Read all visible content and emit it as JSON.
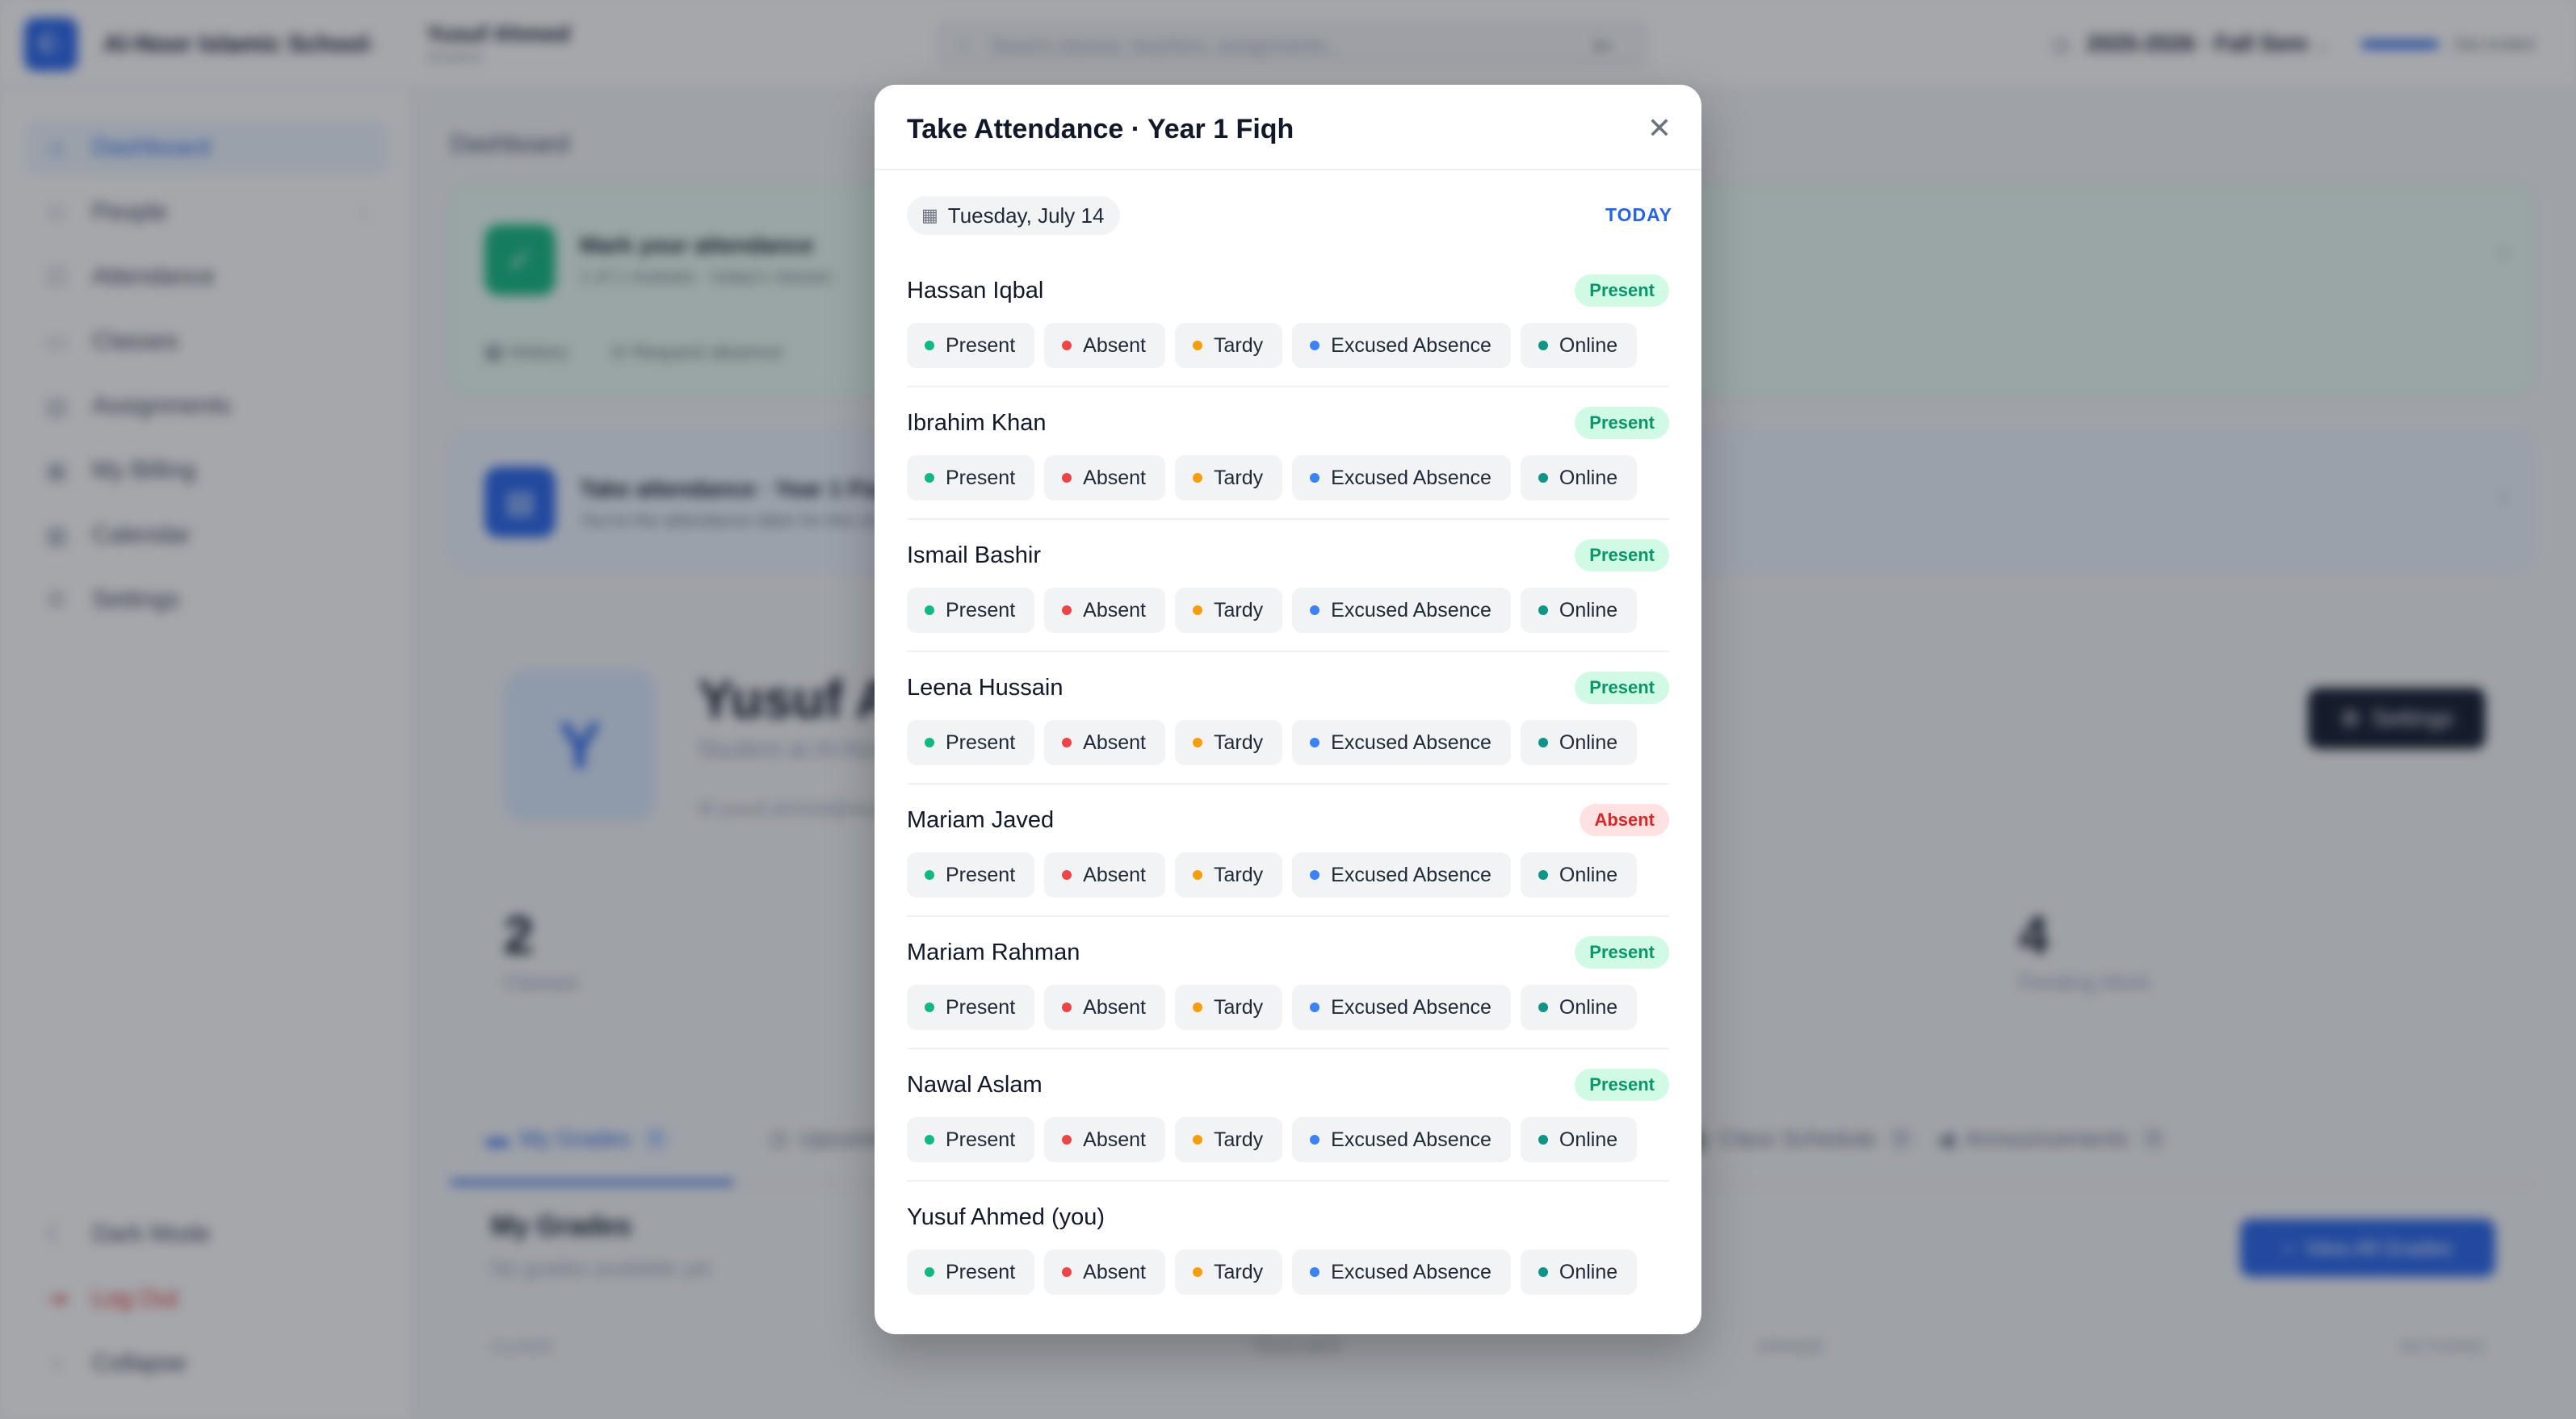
{
  "app": {
    "school_name": "Al-Noor Islamic School",
    "user_name": "Yusuf Ahmed",
    "user_role": "Student",
    "search_placeholder": "Search classes, teachers, assignments...",
    "search_shortcut": "⌘K",
    "school_year": "2025-2026 · Fall Sem",
    "progress_label": "Sat ended",
    "progress_fraction": 0.25
  },
  "sidebar": {
    "items": [
      {
        "label": "Dashboard",
        "icon": "home-icon",
        "active": true
      },
      {
        "label": "People",
        "icon": "people-icon",
        "has_children": true
      },
      {
        "label": "Attendance",
        "icon": "attendance-icon"
      },
      {
        "label": "Classes",
        "icon": "classes-icon"
      },
      {
        "label": "Assignments",
        "icon": "assignments-icon"
      },
      {
        "label": "My Billing",
        "icon": "billing-icon"
      },
      {
        "label": "Calendar",
        "icon": "calendar-icon"
      },
      {
        "label": "Settings",
        "icon": "settings-icon"
      }
    ],
    "bottom": [
      {
        "label": "Dark Mode",
        "icon": "moon-icon"
      },
      {
        "label": "Log Out",
        "icon": "logout-icon",
        "danger": true
      },
      {
        "label": "Collapse",
        "icon": "collapse-icon"
      }
    ]
  },
  "main": {
    "breadcrumb": "Dashboard",
    "attendance_card": {
      "title": "Mark your attendance",
      "subtitle": "1 of 1 modules · today's classes",
      "link_history": "History",
      "link_request": "Request absence"
    },
    "take_card": {
      "title": "Take attendance · Year 1 Fiqh",
      "subtitle": "You're the attendance taker for this class"
    },
    "profile": {
      "avatar_letter": "Y",
      "name": "Yusuf Ahmed",
      "subtitle": "Student at Al-Noor Islamic School",
      "email": "yusuf.ahmed@example.com",
      "settings_label": "Settings"
    },
    "stats": [
      {
        "value": "2",
        "label": "Classes"
      },
      {
        "value": "4",
        "label": "Pending Work"
      }
    ],
    "tabs": [
      {
        "label": "My Grades",
        "count": "0",
        "active": true
      },
      {
        "label": "Upcoming"
      },
      {
        "label": "Class Schedule",
        "count": "0"
      },
      {
        "label": "Announcements",
        "count": "0"
      }
    ],
    "grades": {
      "title": "My Grades",
      "subtitle": "No grades available yet",
      "view_all_label": "View All Grades",
      "columns": [
        "CLASS",
        "TEACHER",
        "GRADE",
        "ACTIONS"
      ]
    }
  },
  "modal": {
    "title": "Take Attendance · Year 1 Fiqh",
    "date": "Tuesday, July 14",
    "today_label": "TODAY",
    "options": [
      {
        "label": "Present",
        "color": "#10b981"
      },
      {
        "label": "Absent",
        "color": "#ef4444"
      },
      {
        "label": "Tardy",
        "color": "#f59e0b"
      },
      {
        "label": "Excused Absence",
        "color": "#3b82f6"
      },
      {
        "label": "Online",
        "color": "#0d9488"
      }
    ],
    "students": [
      {
        "name": "Hassan Iqbal",
        "status": "Present"
      },
      {
        "name": "Ibrahim Khan",
        "status": "Present"
      },
      {
        "name": "Ismail Bashir",
        "status": "Present"
      },
      {
        "name": "Leena Hussain",
        "status": "Present"
      },
      {
        "name": "Mariam Javed",
        "status": "Absent"
      },
      {
        "name": "Mariam Rahman",
        "status": "Present"
      },
      {
        "name": "Nawal Aslam",
        "status": "Present"
      },
      {
        "name": "Yusuf Ahmed (you)",
        "status": ""
      }
    ]
  }
}
